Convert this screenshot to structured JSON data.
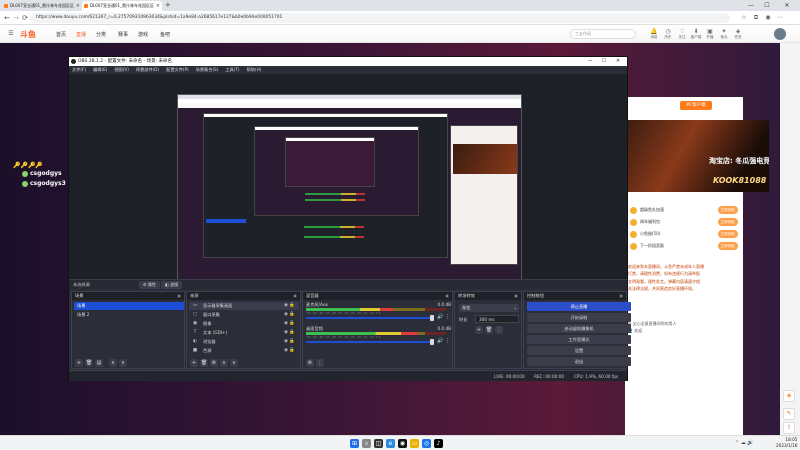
{
  "browser": {
    "tabs": [
      {
        "title": "DL007宣业通01_爬什林车花园区区",
        "active": false
      },
      {
        "title": "DL007宣业通01_爬什林车花园区区",
        "active": true
      }
    ],
    "url": "https://www.douyu.com/621367_r=0.275709310963034&plshid=1a9e84-a2685617e127&b0e0b94e000051701",
    "new_tab": "+",
    "win_min": "—",
    "win_max": "☐",
    "win_close": "✕",
    "back": "←",
    "forward": "→",
    "reload": "⟳"
  },
  "site": {
    "logo": "斗鱼",
    "nav": [
      "首页",
      "直播",
      "分类",
      "赛事",
      "游戏",
      "鱼吧"
    ],
    "search_placeholder": "工友作网",
    "header_icons": [
      {
        "icon": "bell-icon",
        "glyph": "🔔",
        "label": "消息"
      },
      {
        "icon": "history-icon",
        "glyph": "◷",
        "label": "历史"
      },
      {
        "icon": "follow-icon",
        "glyph": "♡",
        "label": "关注"
      },
      {
        "icon": "download-icon",
        "glyph": "⬇",
        "label": "客户端"
      },
      {
        "icon": "live-icon",
        "glyph": "▣",
        "label": "开播"
      },
      {
        "icon": "fish-icon",
        "glyph": "✦",
        "label": "鱼丸"
      },
      {
        "icon": "gift-icon",
        "glyph": "◈",
        "label": "任务"
      }
    ],
    "pc_button": "PC客户端",
    "ad_text1": "淘宝店: 冬瓜强电竞主机",
    "ad_text2": "KOOK81088",
    "gift_rows": [
      {
        "name": "超级鱼丸加速",
        "badge": "立即领取"
      },
      {
        "name": "周年福利包",
        "badge": "立即领取"
      },
      {
        "name": "小鱼翅(50)",
        "badge": "立即领取"
      },
      {
        "name": "下一阶段奖励",
        "badge": "立即领取"
      }
    ],
    "chat_lines": [
      "欢迎来到本直播间，斗鱼严禁未成年人直播",
      "打赏，请理性消费，如有违规行为请举报",
      "文明观看，理性发言。弹幕内容请遵守相",
      "关法律法规，共同营造良好直播环境。"
    ],
    "chat_user_lines": [
      "✉ 全心全意直播间你的男人",
      "👤 欢迎"
    ],
    "left_names": [
      "csgodgys",
      "csgodgys3"
    ],
    "keys_glyphs": "🔑🔑🔑🔑"
  },
  "obs": {
    "title": "OBS 28.1.2 - 配置文件: 未命名 - 场景: 未命名",
    "menu": [
      "文件(F)",
      "编辑(E)",
      "视图(V)",
      "停靠部件(D)",
      "配置文件(P)",
      "场景集合(S)",
      "工具(T)",
      "帮助(H)"
    ],
    "current_source": "未选择源",
    "properties_btn": "⚙ 属性",
    "filters_btn": "◧ 滤镜",
    "docks": {
      "scenes": "场景",
      "sources": "来源",
      "mixer": "混音器",
      "transitions": "转场特效",
      "controls": "控制按钮"
    },
    "scenes": [
      {
        "name": "场景",
        "selected": true
      },
      {
        "name": "场景 2",
        "selected": false
      }
    ],
    "sources": [
      {
        "icon": "monitor-icon",
        "glyph": "▭",
        "name": "显示器采集画面",
        "selected": true
      },
      {
        "icon": "window-icon",
        "glyph": "▢",
        "name": "窗口采集",
        "selected": false
      },
      {
        "icon": "image-icon",
        "glyph": "▣",
        "name": "图像",
        "selected": false
      },
      {
        "icon": "text-icon",
        "glyph": "T",
        "name": "文本 (GDI+)",
        "selected": false
      },
      {
        "icon": "browser-icon",
        "glyph": "◐",
        "name": "浏览器",
        "selected": false
      },
      {
        "icon": "color-icon",
        "glyph": "■",
        "name": "色源",
        "selected": false
      }
    ],
    "mixer": [
      {
        "name": "麦克风/Aux",
        "db": "0.0 dB",
        "level": 0.62
      },
      {
        "name": "桌面音频",
        "db": "0.0 dB",
        "level": 0.8
      }
    ],
    "mixer_scale": "-60 -55 -50 -45 -40 -35 -30 -25 -20 -15 -10 -5 0",
    "transition": {
      "type": "渐变",
      "duration_label": "时长",
      "duration": "300 ms"
    },
    "controls": [
      {
        "label": "停止直播",
        "primary": true
      },
      {
        "label": "开始录制",
        "primary": false
      },
      {
        "label": "启动虚拟摄像机",
        "primary": false
      },
      {
        "label": "工作室模式",
        "primary": false
      },
      {
        "label": "设置",
        "primary": false
      },
      {
        "label": "退出",
        "primary": false
      }
    ],
    "status": {
      "live": "LIVE: 00:00:00",
      "rec": "REC: 00:00:00",
      "cpu": "CPU: 1.9%, 60.00 fps"
    }
  },
  "taskbar": {
    "time": "18:05",
    "date": "2023/1/16",
    "tray": "⌃ ☁ 🔊"
  },
  "colors": {
    "accent": "#ff5d23",
    "obs_primary": "#2c4ec9",
    "obs_bg": "#2b2e38"
  }
}
